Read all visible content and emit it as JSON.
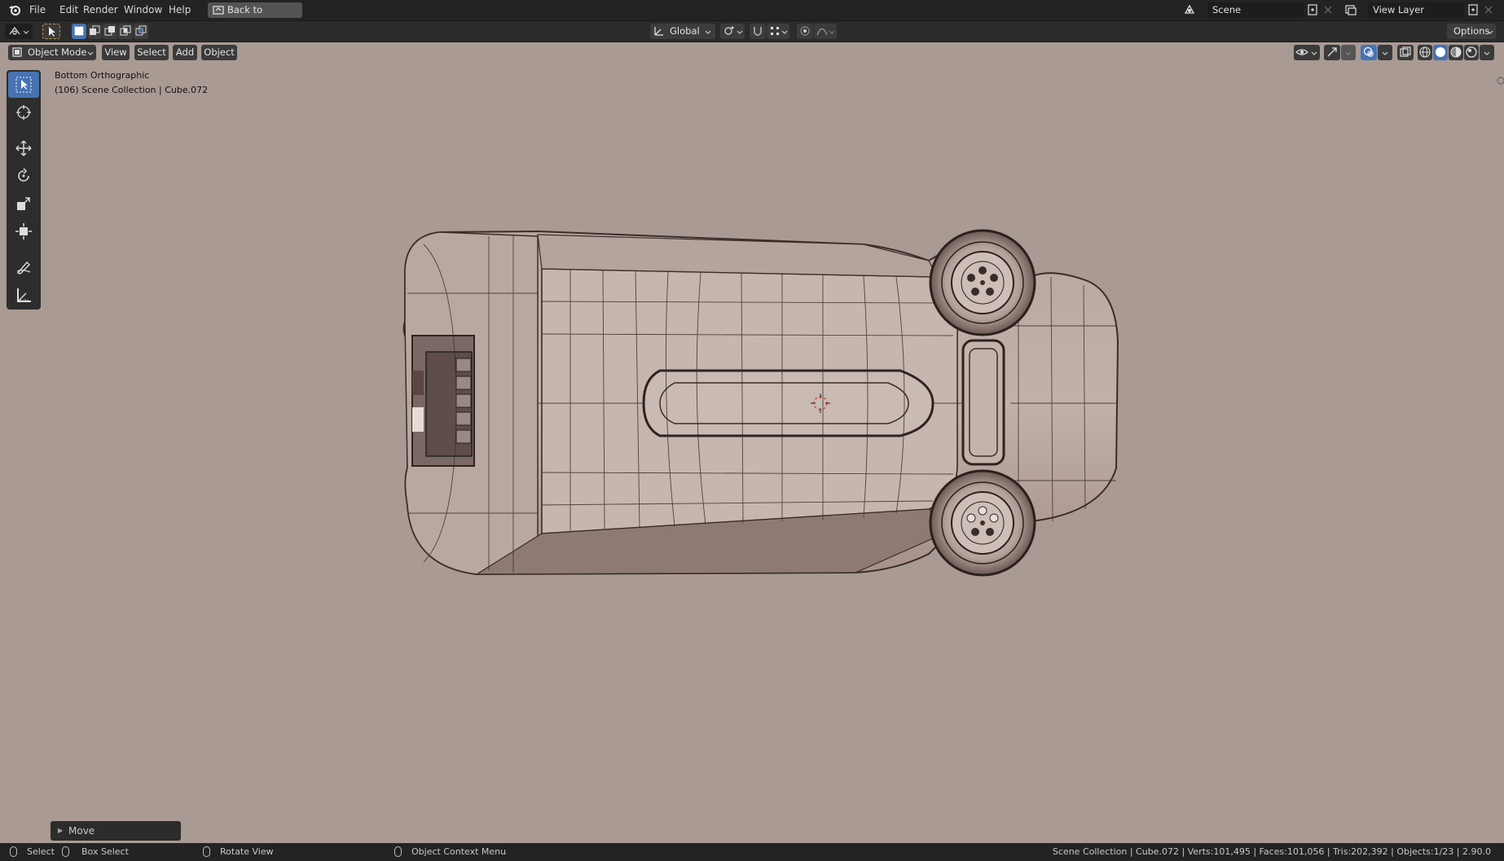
{
  "topbar": {
    "menus": [
      "File",
      "Edit",
      "Render",
      "Window",
      "Help"
    ],
    "back_button": "Back to Previous",
    "scene_name": "Scene",
    "view_layer": "View Layer"
  },
  "header": {
    "orientation": "Global",
    "options_label": "Options"
  },
  "viewport_header": {
    "mode": "Object Mode",
    "menus": [
      "View",
      "Select",
      "Add",
      "Object"
    ]
  },
  "viewport": {
    "view_name": "Bottom Orthographic",
    "collection_info": "(106) Scene Collection | Cube.072"
  },
  "last_operator": {
    "label": "Move"
  },
  "statusbar": {
    "select": "Select",
    "box_select": "Box Select",
    "rotate_view": "Rotate View",
    "context_menu": "Object Context Menu",
    "stats": "Scene Collection | Cube.072 | Verts:101,495 | Faces:101,056 | Tris:202,392 | Objects:1/23 | 2.90.0"
  },
  "colors": {
    "accent": "#4772b3",
    "viewport_bg": "#a99a93",
    "header_bg": "#232323"
  }
}
